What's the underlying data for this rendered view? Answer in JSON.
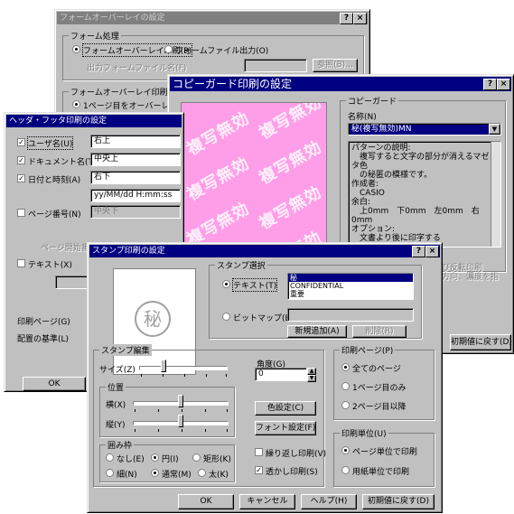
{
  "form_overlay": {
    "title": "フォームオーバーレイの設定",
    "help": "?",
    "close": "×",
    "group_process": "フォーム処理",
    "opt_print": "フォームオーバーレイ印刷(P)",
    "opt_file": "フォームファイル出力(O)",
    "out_file_label": "出力フォームファイル名(F)",
    "browse": "参照(B)...",
    "group_print": "フォームオーバーレイ印刷",
    "opt_page1": "1ページ目をオーバーレイ(1)"
  },
  "copyguard": {
    "title": "コピーガード印刷の設定",
    "help": "?",
    "close": "×",
    "group": "コピーガード",
    "name_label": "名称(N)",
    "name_value": "秘(複写無効)MN",
    "watermark": "複写無効",
    "desc": [
      "パターンの説明:",
      "　複写すると文字の部分が消えるマゼンタ色",
      "　の秘匿の模様です。",
      "作成者:",
      "　CASIO",
      "余白:",
      "　上0mm　下0mm　左0mm　右0mm",
      "オプション:",
      "　文書より後に印字する"
    ],
    "side_text": [
      "よび反転印刷",
      "の方向、濃度を指"
    ],
    "reset": "初期値に戻す(D)"
  },
  "header_footer": {
    "title": "ヘッダ・フッタ印刷の設定",
    "user_label": "ユーザ名(U)",
    "user_value": "右上",
    "doc_label": "ドキュメント名(T)",
    "doc_value": "中央上",
    "date_label": "日付と時刻(A)",
    "date_value": "右下",
    "date_format": "yy/MM/dd H:mm:ss",
    "page_label": "ページ番号(N)",
    "page_value": "中央下",
    "page_start_label": "ページ開始番号(S)",
    "text_label": "テキスト(X)",
    "print_page_label": "印刷ページ(G)",
    "base_label": "配置の基準(L)",
    "ok": "OK"
  },
  "stamp": {
    "title": "スタンプ印刷の設定",
    "help": "?",
    "close": "×",
    "preview_char": "秘",
    "group_select": "スタンプ選択",
    "opt_text": "テキスト(T)",
    "text_items": [
      "秘",
      "CONFIDENTIAL",
      "重要"
    ],
    "opt_bitmap": "ビットマップ(B)",
    "btn_new": "新規追加(A)",
    "btn_delete": "削除(R)",
    "group_edit": "スタンプ編集",
    "size_label": "サイズ(Z)",
    "angle_label": "角度(G)",
    "angle_value": "0",
    "group_position": "位置",
    "horiz_label": "横(X)",
    "vert_label": "縦(Y)",
    "btn_color": "色設定(C)",
    "btn_font": "フォント設定(F)",
    "group_frame": "囲み枠",
    "frame_none": "なし(E)",
    "frame_circle": "円(I)",
    "frame_rect": "矩形(K)",
    "frame_thin": "細(N)",
    "frame_normal": "通常(M)",
    "frame_thick": "太(K)",
    "repeat_label": "繰り返し印刷(V)",
    "transparent_label": "透かし印刷(S)",
    "group_pages": "印刷ページ(P)",
    "pages_all": "全てのページ",
    "pages_first": "1ページ目のみ",
    "pages_second": "2ページ目以降",
    "group_unit": "印刷単位(U)",
    "unit_page": "ページ単位で印刷",
    "unit_paper": "用紙単位で印刷",
    "ok": "OK",
    "cancel": "キャンセル",
    "help_btn": "ヘルプ(H)",
    "reset": "初期値に戻す(D)"
  }
}
